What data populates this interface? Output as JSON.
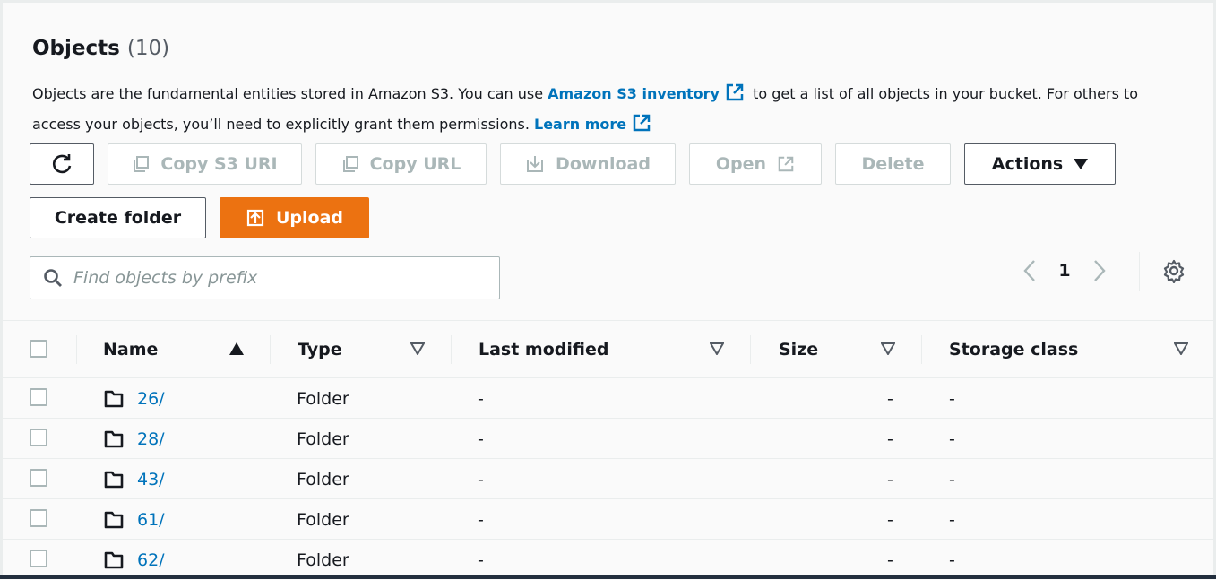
{
  "header": {
    "title": "Objects",
    "count": "(10)",
    "desc_part1": "Objects are the fundamental entities stored in Amazon S3. You can use ",
    "desc_link1": "Amazon S3 inventory",
    "desc_part2": " to get a list of all objects in your bucket. For others to access your objects, you’ll need to explicitly grant them permissions. ",
    "desc_link2": "Learn more"
  },
  "toolbar": {
    "copy_s3_uri": "Copy S3 URI",
    "copy_url": "Copy URL",
    "download": "Download",
    "open": "Open",
    "delete": "Delete",
    "actions": "Actions",
    "create_folder": "Create folder",
    "upload": "Upload"
  },
  "search": {
    "placeholder": "Find objects by prefix"
  },
  "pagination": {
    "current_page": "1"
  },
  "table": {
    "columns": {
      "name": "Name",
      "type": "Type",
      "last_modified": "Last modified",
      "size": "Size",
      "storage_class": "Storage class"
    },
    "rows": [
      {
        "name": "26/",
        "type": "Folder",
        "last_modified": "-",
        "size": "-",
        "storage_class": "-"
      },
      {
        "name": "28/",
        "type": "Folder",
        "last_modified": "-",
        "size": "-",
        "storage_class": "-"
      },
      {
        "name": "43/",
        "type": "Folder",
        "last_modified": "-",
        "size": "-",
        "storage_class": "-"
      },
      {
        "name": "61/",
        "type": "Folder",
        "last_modified": "-",
        "size": "-",
        "storage_class": "-"
      },
      {
        "name": "62/",
        "type": "Folder",
        "last_modified": "-",
        "size": "-",
        "storage_class": "-"
      }
    ]
  },
  "colors": {
    "link": "#0073bb",
    "primary": "#ec7211",
    "disabled": "#aab7b8"
  }
}
